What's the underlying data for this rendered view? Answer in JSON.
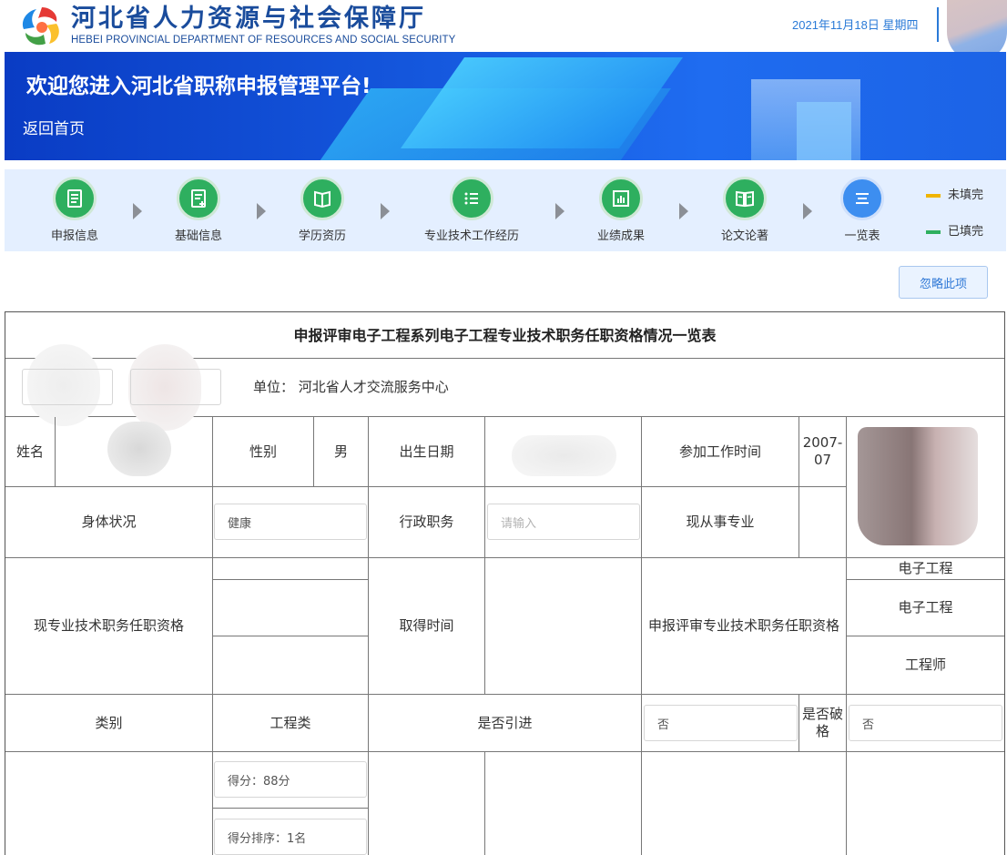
{
  "header": {
    "org_name": "河北省人力资源与社会保障厅",
    "org_name_en": "HEBEI PROVINCIAL DEPARTMENT OF RESOURCES AND SOCIAL SECURITY",
    "date": "2021年11月18日 星期四"
  },
  "banner": {
    "title": "欢迎您进入河北省职称申报管理平台!",
    "home_link": "返回首页"
  },
  "steps": [
    {
      "label": "申报信息",
      "icon": "form-icon",
      "status": "filled"
    },
    {
      "label": "基础信息",
      "icon": "form-add-icon",
      "status": "filled"
    },
    {
      "label": "学历资历",
      "icon": "book-icon",
      "status": "filled"
    },
    {
      "label": "专业技术工作经历",
      "icon": "list-icon",
      "status": "filled"
    },
    {
      "label": "业绩成果",
      "icon": "bar-chart-icon",
      "status": "filled"
    },
    {
      "label": "论文论著",
      "icon": "open-book-icon",
      "status": "filled"
    },
    {
      "label": "一览表",
      "icon": "menu-icon",
      "status": "current"
    }
  ],
  "legend": {
    "unfilled": "未填完",
    "filled": "已填完",
    "unfilled_color": "#f0b400",
    "filled_color": "#2eaf5f"
  },
  "skip_button": "忽略此项",
  "table": {
    "title": "申报评审电子工程系列电子工程专业技术职务任职资格情况一览表",
    "unit_label": "单位： 河北省人才交流服务中心",
    "name_label": "姓名",
    "gender_label": "性别",
    "gender_value": "男",
    "birth_label": "出生日期",
    "work_start_label": "参加工作时间",
    "work_start_value": "2007-07",
    "health_label": "身体状况",
    "health_value": "健康",
    "admin_post_label": "行政职务",
    "admin_post_placeholder": "请输入",
    "current_major_label": "现从事专业",
    "current_qual_label": "现专业技术职务任职资格",
    "obtain_time_label": "取得时间",
    "apply_qual_label": "申报评审专业技术职务任职资格",
    "apply_values": [
      "电子工程",
      "电子工程",
      "工程师"
    ],
    "category_label": "类别",
    "category_value": "工程类",
    "introduced_label": "是否引进",
    "introduced_value": "否",
    "exceptional_label": "是否破格",
    "exceptional_value": "否",
    "score": "得分：88分",
    "rank": "得分排序：1名"
  }
}
